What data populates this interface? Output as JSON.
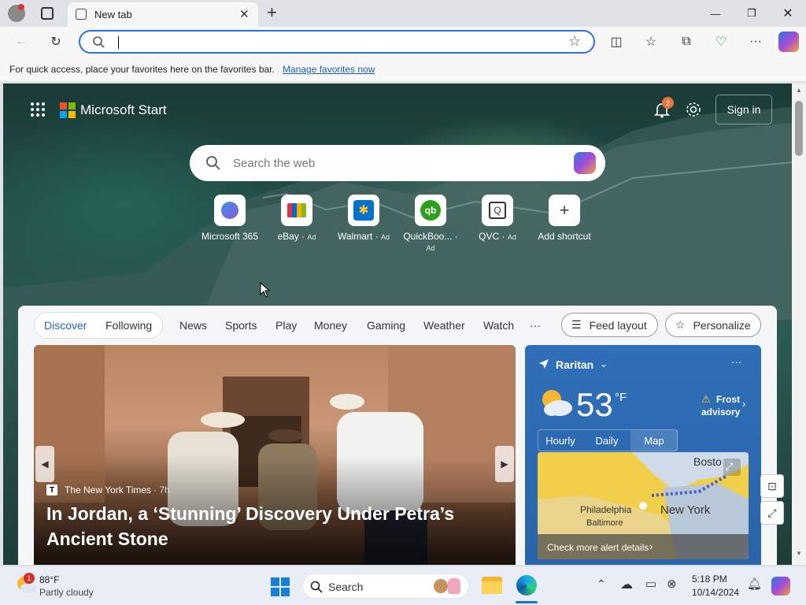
{
  "browser": {
    "tab_title": "New tab",
    "favbar_message": "For quick access, place your favorites here on the favorites bar.",
    "favbar_link": "Manage favorites now"
  },
  "start": {
    "brand": "Microsoft Start",
    "notification_count": "2",
    "sign_in": "Sign in",
    "search_placeholder": "Search the web",
    "shortcuts": [
      {
        "label": "Microsoft 365",
        "ad": "",
        "icon": "microsoft-365-icon",
        "color": "#6b5bd6"
      },
      {
        "label": "eBay",
        "ad": "Ad",
        "icon": "ebay-icon",
        "color": "#e53238"
      },
      {
        "label": "Walmart",
        "ad": "Ad",
        "icon": "walmart-icon",
        "color": "#0071ce"
      },
      {
        "label": "QuickBoo...",
        "ad": "Ad",
        "icon": "quickbooks-icon",
        "color": "#2ca01c"
      },
      {
        "label": "QVC",
        "ad": "Ad",
        "icon": "qvc-icon",
        "color": "#333333"
      },
      {
        "label": "Add shortcut",
        "ad": "",
        "icon": "plus-icon",
        "color": "#444444"
      }
    ]
  },
  "feed": {
    "tabs": [
      "Discover",
      "Following"
    ],
    "nav": [
      "News",
      "Sports",
      "Play",
      "Money",
      "Gaming",
      "Weather",
      "Watch"
    ],
    "more": "···",
    "feed_layout": "Feed layout",
    "personalize": "Personalize",
    "hero": {
      "source": "The New York Times",
      "age": "· 7h",
      "headline": "In Jordan, a ‘Stunning’ Discovery Under Petra’s Ancient Stone"
    }
  },
  "weather": {
    "location": "Raritan",
    "temp": "53",
    "unit": "°F",
    "alert_line1": "Frost",
    "alert_line2": "advisory",
    "tabs": [
      "Hourly",
      "Daily",
      "Map"
    ],
    "map_labels": [
      "Bosto",
      "Philadelphia",
      "Baltimore",
      "New York"
    ],
    "alert_link": "Check more alert details",
    "more": "···"
  },
  "taskbar": {
    "temp": "88°F",
    "condition": "Partly cloudy",
    "badge": "1",
    "search": "Search",
    "time": "5:18 PM",
    "date": "10/14/2024"
  },
  "colors": {
    "accent": "#2f6fdc",
    "weather_bg": "#2f6fb7"
  }
}
